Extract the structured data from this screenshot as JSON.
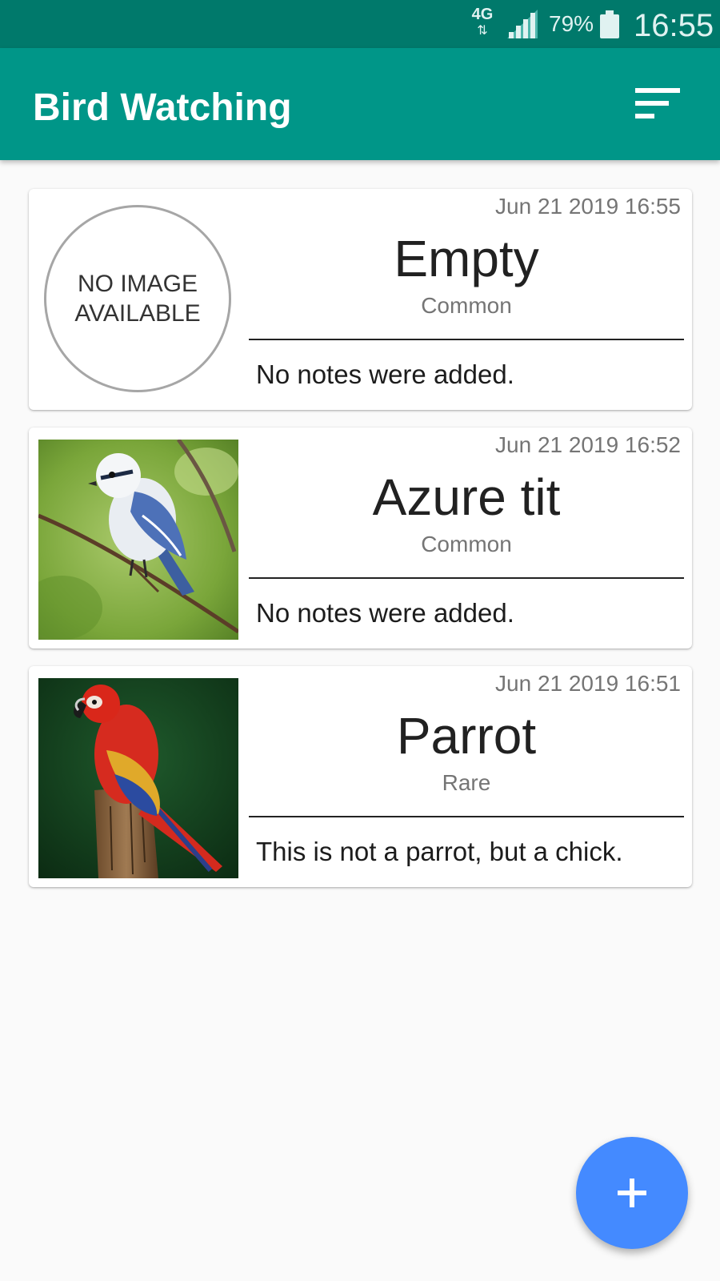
{
  "status_bar": {
    "network": "4G",
    "network_arrows": "⇅",
    "signal_icon": "signal-icon",
    "battery_percent": "79%",
    "battery_icon": "battery-icon",
    "time": "16:55"
  },
  "app_bar": {
    "title": "Bird Watching",
    "sort_icon": "sort-icon",
    "color": "#009688"
  },
  "placeholder": {
    "no_image_text": "NO IMAGE AVAILABLE"
  },
  "birds": [
    {
      "date": "Jun 21 2019 16:55",
      "name": "Empty",
      "rarity": "Common",
      "notes": "No notes were added.",
      "image": "none"
    },
    {
      "date": "Jun 21 2019 16:52",
      "name": "Azure tit",
      "rarity": "Common",
      "notes": "No notes were added.",
      "image": "azure-tit-photo"
    },
    {
      "date": "Jun 21 2019 16:51",
      "name": "Parrot",
      "rarity": "Rare",
      "notes": "This is not a parrot, but a chick.",
      "image": "parrot-photo"
    }
  ],
  "fab": {
    "icon": "plus-icon",
    "color": "#448aff"
  }
}
